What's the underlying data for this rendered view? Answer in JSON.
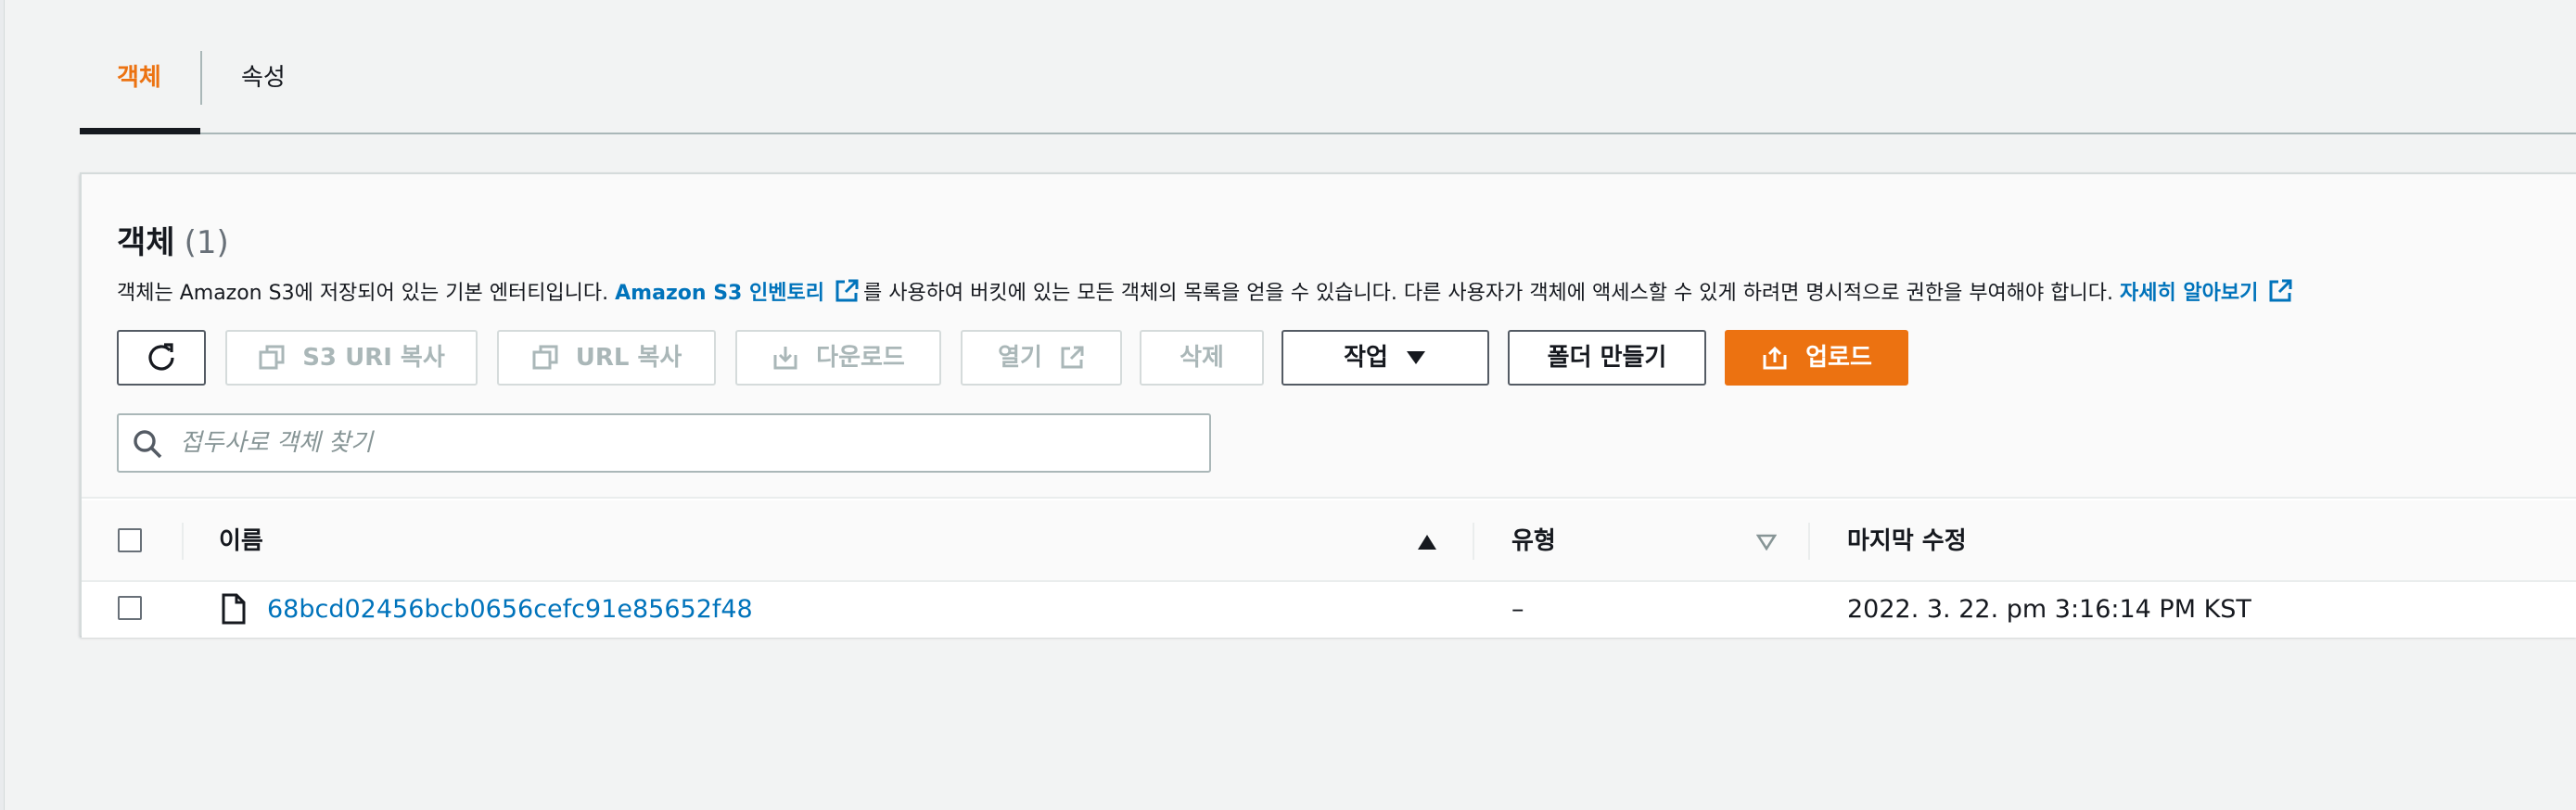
{
  "tabs": [
    {
      "label": "객체",
      "active": true
    },
    {
      "label": "속성",
      "active": false
    }
  ],
  "section": {
    "title": "객체",
    "count": "(1)",
    "description_1": "객체는 Amazon S3에 저장되어 있는 기본 엔터티입니다. ",
    "inventory_link": "Amazon S3 인벤토리",
    "description_2": "를 사용하여 버킷에 있는 모든 객체의 목록을 얻을 수 있습니다. 다른 사용자가 객체에 액세스할 수 있게 하려면 명시적으로 권한을 부여해야 합니다. ",
    "learn_more_link": "자세히 알아보기"
  },
  "toolbar": {
    "copy_s3_uri": "S3 URI 복사",
    "copy_url": "URL 복사",
    "download": "다운로드",
    "open": "열기",
    "delete": "삭제",
    "actions": "작업",
    "create_folder": "폴더 만들기",
    "upload": "업로드"
  },
  "search": {
    "placeholder": "접두사로 객체 찾기",
    "value": ""
  },
  "table": {
    "columns": {
      "name": "이름",
      "type": "유형",
      "last_modified": "마지막 수정"
    },
    "rows": [
      {
        "name": "68bcd02456bcb0656cefc91e85652f48",
        "type": "–",
        "last_modified": "2022. 3. 22. pm 3:16:14 PM KST"
      }
    ]
  },
  "colors": {
    "accent_orange": "#ec7211",
    "link_blue": "#0073bb",
    "disabled_gray": "#aab7b8"
  },
  "icons": [
    "refresh-icon",
    "copy-icon",
    "download-icon",
    "external-link-icon",
    "caret-down-icon",
    "upload-icon",
    "search-icon",
    "sort-ascending-icon",
    "sort-icon",
    "file-icon"
  ]
}
